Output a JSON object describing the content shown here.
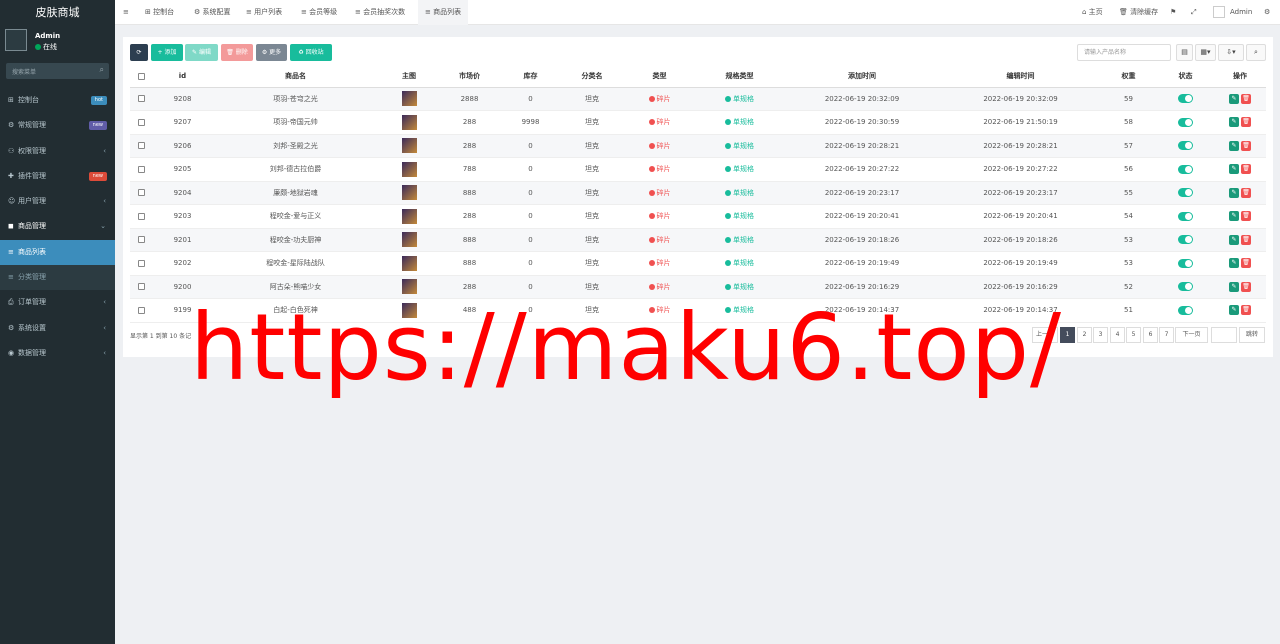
{
  "sidebar": {
    "brand": "皮肤商城",
    "user": {
      "name": "Admin",
      "status": "在线"
    },
    "search_placeholder": "搜索菜单",
    "items": [
      {
        "icon": "⊞",
        "label": "控制台",
        "badge": "hot",
        "badge_color": "#3c8dbc"
      },
      {
        "icon": "⚙",
        "label": "常规管理",
        "badge": "new",
        "badge_color": "#605ca8"
      },
      {
        "icon": "⚇",
        "label": "权限管理",
        "chevron": "‹"
      },
      {
        "icon": "✚",
        "label": "插件管理",
        "badge": "new",
        "badge_color": "#dd4b39"
      },
      {
        "icon": "☺",
        "label": "用户管理",
        "chevron": "‹"
      },
      {
        "icon": "◼",
        "label": "商品管理",
        "chevron": "⌄"
      },
      {
        "icon": "≡",
        "label": "商品列表"
      },
      {
        "icon": "≡",
        "label": "分类管理"
      },
      {
        "icon": "⎙",
        "label": "订单管理",
        "chevron": "‹"
      },
      {
        "icon": "⚙",
        "label": "系统设置",
        "chevron": "‹"
      },
      {
        "icon": "◉",
        "label": "数据管理",
        "chevron": "‹"
      }
    ]
  },
  "topbar": {
    "menu_icon": "≡",
    "tabs": [
      "控制台",
      "系统配置",
      "用户列表",
      "会员等级",
      "会员抽奖次数",
      "商品列表"
    ],
    "right": {
      "home": "主页",
      "clear_cache": "清除缓存",
      "admin": "Admin"
    }
  },
  "toolbar": {
    "refresh": "⟳",
    "add": "添加",
    "edit": "编辑",
    "delete": "删除",
    "more": "更多",
    "recycle": "回收站",
    "search_placeholder": "请输入产品名称"
  },
  "table": {
    "headers": [
      "",
      "id",
      "商品名",
      "主图",
      "市场价",
      "库存",
      "分类名",
      "类型",
      "规格类型",
      "添加时间",
      "编辑时间",
      "权重",
      "状态",
      "操作"
    ],
    "rows": [
      {
        "id": "9208",
        "name": "项羽-苍穹之光",
        "price": "2888",
        "stock": "0",
        "category": "坦克",
        "type": "碎片",
        "spec": "单规格",
        "added": "2022-06-19 20:32:09",
        "edited": "2022-06-19 20:32:09",
        "weight": "59"
      },
      {
        "id": "9207",
        "name": "项羽-帝国元帅",
        "price": "288",
        "stock": "9998",
        "category": "坦克",
        "type": "碎片",
        "spec": "单规格",
        "added": "2022-06-19 20:30:59",
        "edited": "2022-06-19 21:50:19",
        "weight": "58"
      },
      {
        "id": "9206",
        "name": "刘邦-圣殿之光",
        "price": "288",
        "stock": "0",
        "category": "坦克",
        "type": "碎片",
        "spec": "单规格",
        "added": "2022-06-19 20:28:21",
        "edited": "2022-06-19 20:28:21",
        "weight": "57"
      },
      {
        "id": "9205",
        "name": "刘邦-德古拉伯爵",
        "price": "788",
        "stock": "0",
        "category": "坦克",
        "type": "碎片",
        "spec": "单规格",
        "added": "2022-06-19 20:27:22",
        "edited": "2022-06-19 20:27:22",
        "weight": "56"
      },
      {
        "id": "9204",
        "name": "廉颇-地狱岩魂",
        "price": "888",
        "stock": "0",
        "category": "坦克",
        "type": "碎片",
        "spec": "单规格",
        "added": "2022-06-19 20:23:17",
        "edited": "2022-06-19 20:23:17",
        "weight": "55"
      },
      {
        "id": "9203",
        "name": "程咬金-爱与正义",
        "price": "288",
        "stock": "0",
        "category": "坦克",
        "type": "碎片",
        "spec": "单规格",
        "added": "2022-06-19 20:20:41",
        "edited": "2022-06-19 20:20:41",
        "weight": "54"
      },
      {
        "id": "9201",
        "name": "程咬金-功夫厨神",
        "price": "888",
        "stock": "0",
        "category": "坦克",
        "type": "碎片",
        "spec": "单规格",
        "added": "2022-06-19 20:18:26",
        "edited": "2022-06-19 20:18:26",
        "weight": "53"
      },
      {
        "id": "9202",
        "name": "程咬金-星际陆战队",
        "price": "888",
        "stock": "0",
        "category": "坦克",
        "type": "碎片",
        "spec": "单规格",
        "added": "2022-06-19 20:19:49",
        "edited": "2022-06-19 20:19:49",
        "weight": "53"
      },
      {
        "id": "9200",
        "name": "阿古朵-熊喵少女",
        "price": "288",
        "stock": "0",
        "category": "坦克",
        "type": "碎片",
        "spec": "单规格",
        "added": "2022-06-19 20:16:29",
        "edited": "2022-06-19 20:16:29",
        "weight": "52"
      },
      {
        "id": "9199",
        "name": "白起-白色死神",
        "price": "488",
        "stock": "0",
        "category": "坦克",
        "type": "碎片",
        "spec": "单规格",
        "added": "2022-06-19 20:14:37",
        "edited": "2022-06-19 20:14:37",
        "weight": "51"
      }
    ]
  },
  "footer": {
    "info": "显示第 1 到第 10 条记",
    "prev": "上一页",
    "pages": [
      "1",
      "2",
      "3",
      "4",
      "5",
      "6",
      "7"
    ],
    "next": "下一页",
    "goto": "跳转"
  },
  "watermark": "https://maku6.top/",
  "colors": {
    "sidebar_bg": "#222d32",
    "active_blue": "#3c8dbc",
    "green": "#18bc9c",
    "red": "#f05050",
    "dark_green": "#1a9a7a"
  }
}
